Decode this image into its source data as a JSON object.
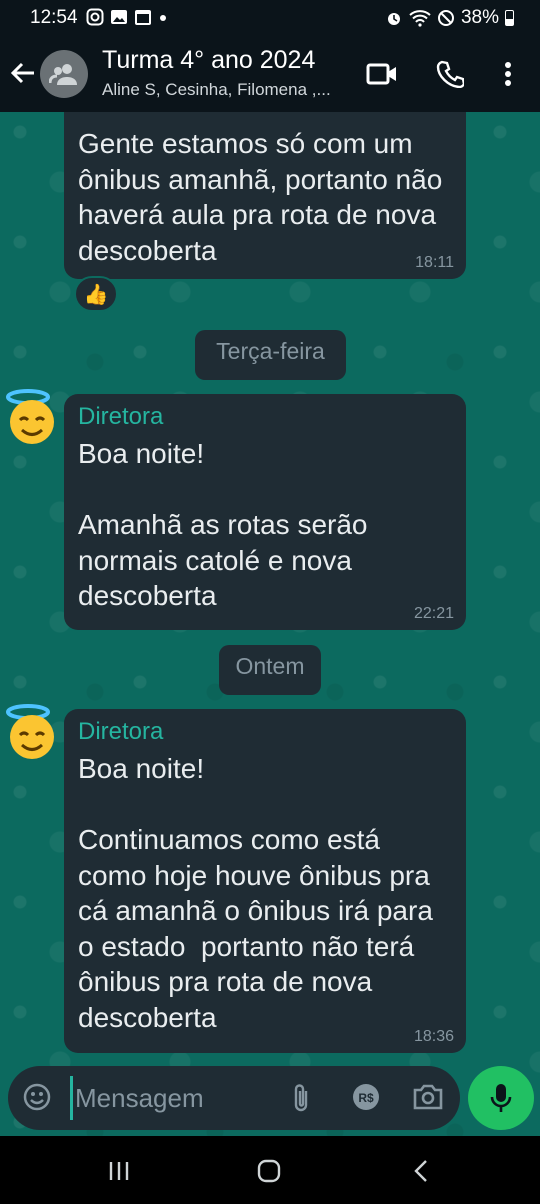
{
  "status_bar": {
    "time": "12:54",
    "battery": "38%"
  },
  "header": {
    "title": "Turma 4° ano 2024",
    "subtitle": "Aline S, Cesinha, Filomena ,..."
  },
  "messages": [
    {
      "text": "Gente estamos só com um ônibus amanhã, portanto não haverá aula pra rota de nova descoberta",
      "time": "18:11",
      "reaction": "👍"
    },
    {
      "sender": "Diretora",
      "text": "Boa noite!\n\nAmanhã as rotas serão normais catolé e nova descoberta",
      "time": "22:21"
    },
    {
      "sender": "Diretora",
      "text": "Boa noite!\n\nContinuamos como está como hoje houve ônibus pra cá amanhã o ônibus irá para o estado  portanto não terá ônibus pra rota de nova descoberta",
      "time": "18:36"
    }
  ],
  "date_chips": [
    "Terça-feira",
    "Ontem"
  ],
  "composer": {
    "placeholder": "Mensagem"
  },
  "colors": {
    "accent": "#25b5a0",
    "mic": "#21c063",
    "bubble": "#1f2c34",
    "wallpaper": "#0c6a5f"
  }
}
